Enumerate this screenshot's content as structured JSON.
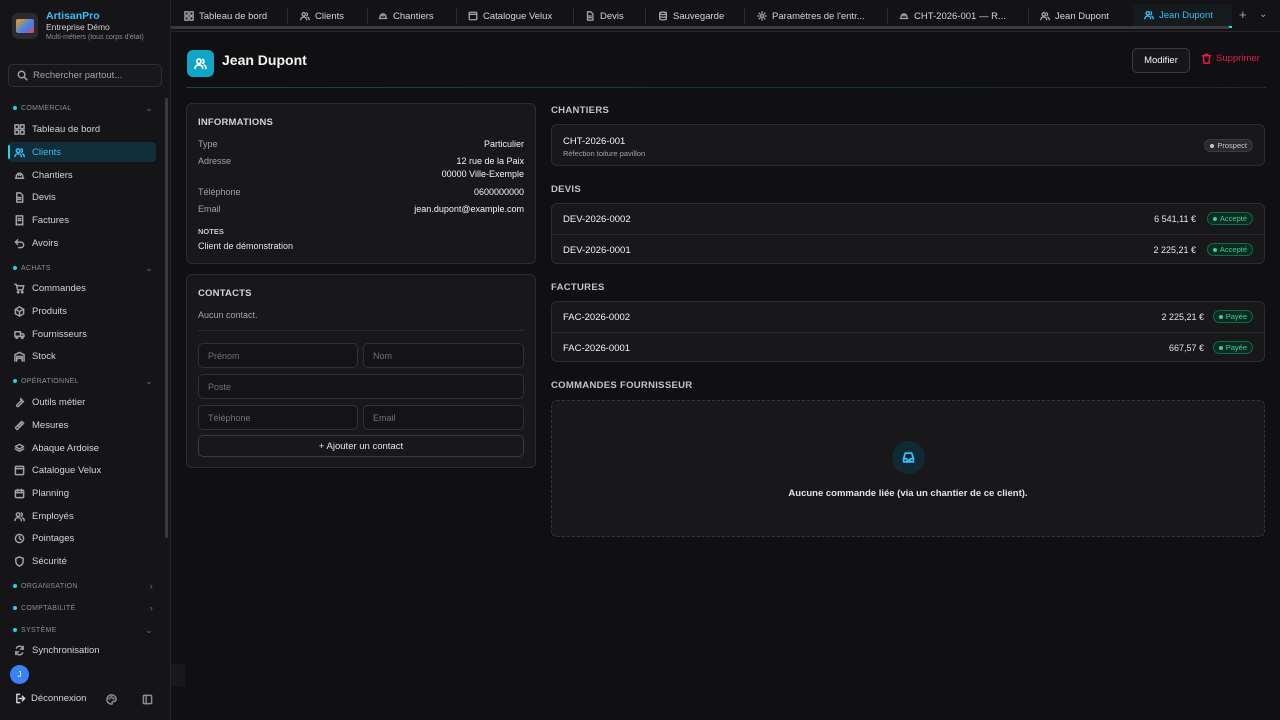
{
  "brand": {
    "name": "ArtisanPro",
    "company": "Entreprise Démo",
    "subtitle": "Multi-métiers (tous corps d'état)"
  },
  "search": {
    "placeholder": "Rechercher partout..."
  },
  "sidebar": {
    "sections": [
      {
        "label": "COMMERCIAL",
        "chevron": "⌄"
      },
      {
        "label": "ACHATS",
        "chevron": "⌄"
      },
      {
        "label": "OPÉRATIONNEL",
        "chevron": "⌄"
      },
      {
        "label": "ORGANISATION",
        "chevron": "›"
      },
      {
        "label": "COMPTABILITÉ",
        "chevron": "›"
      },
      {
        "label": "SYSTÈME",
        "chevron": "⌄"
      }
    ],
    "items": [
      {
        "label": "Tableau de bord",
        "icon": "dashboard-icon"
      },
      {
        "label": "Clients",
        "icon": "users-icon",
        "active": true
      },
      {
        "label": "Chantiers",
        "icon": "hardhat-icon"
      },
      {
        "label": "Devis",
        "icon": "file-icon"
      },
      {
        "label": "Factures",
        "icon": "receipt-icon"
      },
      {
        "label": "Avoirs",
        "icon": "undo-icon"
      },
      {
        "label": "Commandes",
        "icon": "cart-icon"
      },
      {
        "label": "Produits",
        "icon": "box-icon"
      },
      {
        "label": "Fournisseurs",
        "icon": "truck-icon"
      },
      {
        "label": "Stock",
        "icon": "warehouse-icon"
      },
      {
        "label": "Outils métier",
        "icon": "wrench-icon"
      },
      {
        "label": "Mesures",
        "icon": "ruler-icon"
      },
      {
        "label": "Abaque Ardoise",
        "icon": "layers-icon"
      },
      {
        "label": "Catalogue Velux",
        "icon": "window-icon"
      },
      {
        "label": "Planning",
        "icon": "calendar-icon"
      },
      {
        "label": "Employés",
        "icon": "users-icon"
      },
      {
        "label": "Pointages",
        "icon": "clock-icon"
      },
      {
        "label": "Sécurité",
        "icon": "shield-icon"
      },
      {
        "label": "Synchronisation",
        "icon": "sync-icon"
      }
    ],
    "avatar_initial": "J",
    "logout_label": "Déconnexion"
  },
  "tabs": [
    {
      "label": "Tableau de bord",
      "icon": "dashboard-icon"
    },
    {
      "label": "Clients",
      "icon": "users-icon"
    },
    {
      "label": "Chantiers",
      "icon": "hardhat-icon"
    },
    {
      "label": "Catalogue Velux",
      "icon": "window-icon"
    },
    {
      "label": "Devis",
      "icon": "file-icon"
    },
    {
      "label": "Sauvegarde",
      "icon": "database-icon"
    },
    {
      "label": "Paramètres de l'entr...",
      "icon": "gear-icon"
    },
    {
      "label": "CHT-2026-001 — R...",
      "icon": "hardhat-icon"
    },
    {
      "label": "Jean Dupont",
      "icon": "users-icon"
    },
    {
      "label": "Jean Dupont",
      "icon": "users-icon",
      "active": true
    }
  ],
  "tabbar": {
    "add": "+",
    "more": "⌄"
  },
  "header": {
    "title": "Jean Dupont",
    "edit_label": "Modifier",
    "delete_label": "Supprimer"
  },
  "informations": {
    "title": "INFORMATIONS",
    "type_label": "Type",
    "type_value": "Particulier",
    "address_label": "Adresse",
    "address_line1": "12 rue de la Paix",
    "address_line2": "00000 Ville-Exemple",
    "phone_label": "Téléphone",
    "phone_value": "0600000000",
    "email_label": "Email",
    "email_value": "jean.dupont@example.com",
    "notes_label": "NOTES",
    "notes_value": "Client de démonstration"
  },
  "contacts": {
    "title": "CONTACTS",
    "empty": "Aucun contact.",
    "firstname_placeholder": "Prénom",
    "lastname_placeholder": "Nom",
    "position_placeholder": "Poste",
    "phone_placeholder": "Téléphone",
    "email_placeholder": "Email",
    "add_label": "+ Ajouter un contact"
  },
  "chantiers": {
    "title": "CHANTIERS",
    "items": [
      {
        "ref": "CHT-2026-001",
        "desc": "Réfection toiture pavillon",
        "status": "Prospect"
      }
    ]
  },
  "devis": {
    "title": "DEVIS",
    "items": [
      {
        "ref": "DEV-2026-0002",
        "amount": "6 541,11 €",
        "status": "Accepté"
      },
      {
        "ref": "DEV-2026-0001",
        "amount": "2 225,21 €",
        "status": "Accepté"
      }
    ]
  },
  "factures": {
    "title": "FACTURES",
    "items": [
      {
        "ref": "FAC-2026-0002",
        "amount": "2 225,21 €",
        "status": "Payée"
      },
      {
        "ref": "FAC-2026-0001",
        "amount": "667,57 €",
        "status": "Payée"
      }
    ]
  },
  "commandes": {
    "title": "COMMANDES FOURNISSEUR",
    "empty": "Aucune commande liée (via un chantier de ce client)."
  },
  "colors": {
    "accent": "#22d3ee",
    "danger": "#e11d48",
    "success": "#34d399",
    "background": "#101012"
  }
}
